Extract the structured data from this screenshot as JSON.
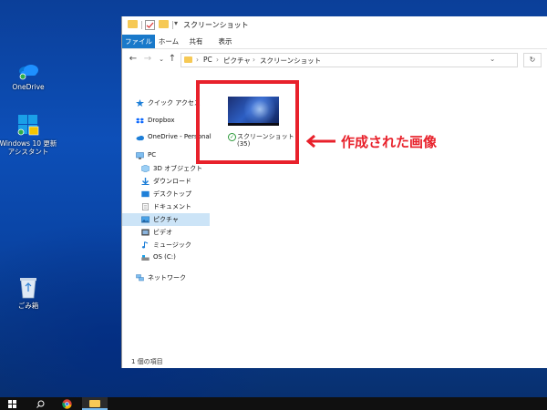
{
  "desktop": {
    "icons": [
      {
        "label": "OneDrive",
        "icon": "onedrive-icon"
      },
      {
        "label": "Windows 10 更新アシスタント",
        "icon": "windows-update-assistant-icon"
      },
      {
        "label": "ごみ箱",
        "icon": "recycle-bin-icon"
      }
    ]
  },
  "window": {
    "title": "スクリーンショット",
    "ribbon_tabs": [
      "ファイル",
      "ホーム",
      "共有",
      "表示"
    ],
    "breadcrumb": [
      "PC",
      "ピクチャ",
      "スクリーンショット"
    ]
  },
  "nav": {
    "items": [
      {
        "label": "クイック アクセス",
        "icon": "star-icon"
      },
      {
        "label": "Dropbox",
        "icon": "dropbox-icon"
      },
      {
        "label": "OneDrive - Personal",
        "icon": "onedrive-icon"
      },
      {
        "label": "PC",
        "icon": "pc-icon"
      },
      {
        "label": "3D オブジェクト",
        "icon": "3d-objects-icon"
      },
      {
        "label": "ダウンロード",
        "icon": "download-icon"
      },
      {
        "label": "デスクトップ",
        "icon": "desktop-folder-icon"
      },
      {
        "label": "ドキュメント",
        "icon": "documents-icon"
      },
      {
        "label": "ピクチャ",
        "icon": "pictures-icon",
        "selected": true
      },
      {
        "label": "ビデオ",
        "icon": "videos-icon"
      },
      {
        "label": "ミュージック",
        "icon": "music-icon"
      },
      {
        "label": "OS (C:)",
        "icon": "drive-icon"
      },
      {
        "label": "ネットワーク",
        "icon": "network-icon"
      }
    ]
  },
  "content": {
    "file": {
      "name": "スクリーンショット",
      "count": "(35)"
    }
  },
  "annotation": {
    "text": "作成された画像",
    "color": "#e8212b"
  },
  "status": {
    "items": "1 個の項目"
  },
  "colors": {
    "accent": "#1979ca",
    "highlight": "#e8212b",
    "selected_nav": "#cce4f7"
  }
}
